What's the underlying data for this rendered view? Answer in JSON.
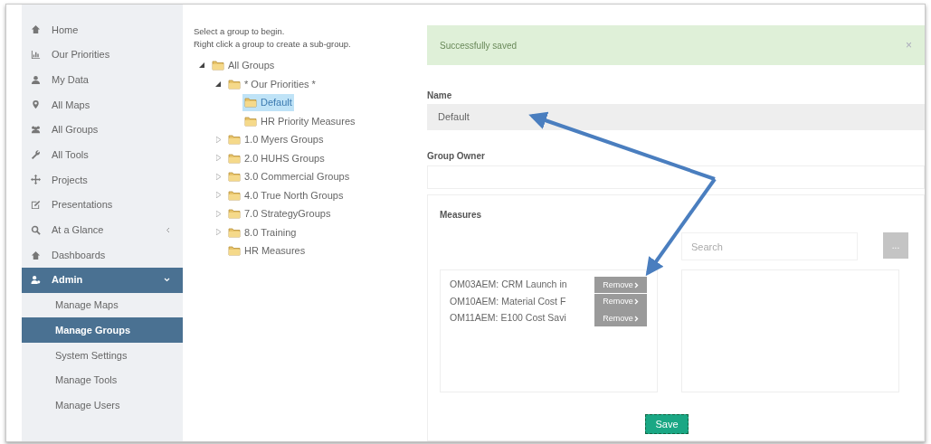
{
  "sidebar": {
    "items": [
      {
        "label": "Home",
        "selected": false
      },
      {
        "label": "Our Priorities",
        "selected": false
      },
      {
        "label": "My Data",
        "selected": false
      },
      {
        "label": "All Maps",
        "selected": false
      },
      {
        "label": "All Groups",
        "selected": false
      },
      {
        "label": "All Tools",
        "selected": false
      },
      {
        "label": "Projects",
        "selected": false
      },
      {
        "label": "Presentations",
        "selected": false
      },
      {
        "label": "At a Glance",
        "selected": false,
        "expanded": false
      },
      {
        "label": "Dashboards",
        "selected": false
      },
      {
        "label": "Admin",
        "selected": true,
        "expanded": true,
        "children": [
          {
            "label": "Manage Maps",
            "selected": false
          },
          {
            "label": "Manage Groups",
            "selected": true
          },
          {
            "label": "System Settings",
            "selected": false
          },
          {
            "label": "Manage Tools",
            "selected": false
          },
          {
            "label": "Manage Users",
            "selected": false
          }
        ]
      }
    ]
  },
  "tree": {
    "instructions": [
      "Select a group to begin.",
      "Right click a group to create a sub-group."
    ],
    "nodes": [
      {
        "label": "All Groups",
        "expanded": true,
        "selected": false,
        "children": [
          {
            "label": "* Our Priorities *",
            "expanded": true,
            "selected": false,
            "children": [
              {
                "label": "Default",
                "selected": true
              },
              {
                "label": "HR Priority Measures",
                "selected": false
              }
            ]
          },
          {
            "label": "1.0 Myers Groups",
            "expanded": false,
            "selected": false
          },
          {
            "label": "2.0 HUHS Groups",
            "expanded": false,
            "selected": false
          },
          {
            "label": "3.0 Commercial Groups",
            "expanded": false,
            "selected": false
          },
          {
            "label": "4.0 True North Groups",
            "expanded": false,
            "selected": false
          },
          {
            "label": "7.0 StrategyGroups",
            "expanded": false,
            "selected": false
          },
          {
            "label": "8.0 Training",
            "expanded": false,
            "selected": false
          },
          {
            "label": "HR Measures",
            "selected": false
          }
        ]
      }
    ]
  },
  "alert": {
    "message": "Successfully saved",
    "close": "×"
  },
  "form": {
    "name_label": "Name",
    "name_value": "Default",
    "owner_label": "Group Owner"
  },
  "measures": {
    "title": "Measures",
    "search_placeholder": "Search",
    "search_button": "...",
    "selected_items": [
      {
        "text": "OM03AEM: CRM Launch in",
        "action": "Remove"
      },
      {
        "text": "OM10AEM: Material Cost F",
        "action": "Remove"
      },
      {
        "text": "OM11AEM: E100 Cost Savi",
        "action": "Remove"
      }
    ]
  },
  "save_button": "Save"
}
